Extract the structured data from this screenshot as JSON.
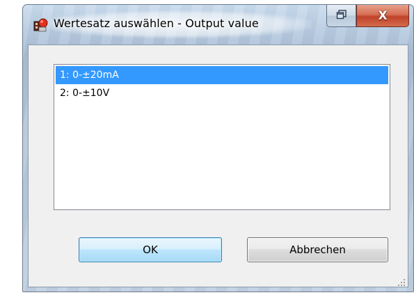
{
  "window": {
    "title": "Wertesatz auswählen - Output value",
    "close_glyph": "X",
    "icon": "app-icon",
    "restore_icon": "restore-window-icon"
  },
  "list": {
    "items": [
      {
        "label": "1: 0-±20mA",
        "selected": true
      },
      {
        "label": "2: 0-±10V",
        "selected": false
      }
    ]
  },
  "buttons": {
    "ok_label": "OK",
    "cancel_label": "Abbrechen"
  },
  "colors": {
    "selection": "#3399ff",
    "close_button": "#c0432a",
    "default_button_border": "#3c7fb1"
  }
}
